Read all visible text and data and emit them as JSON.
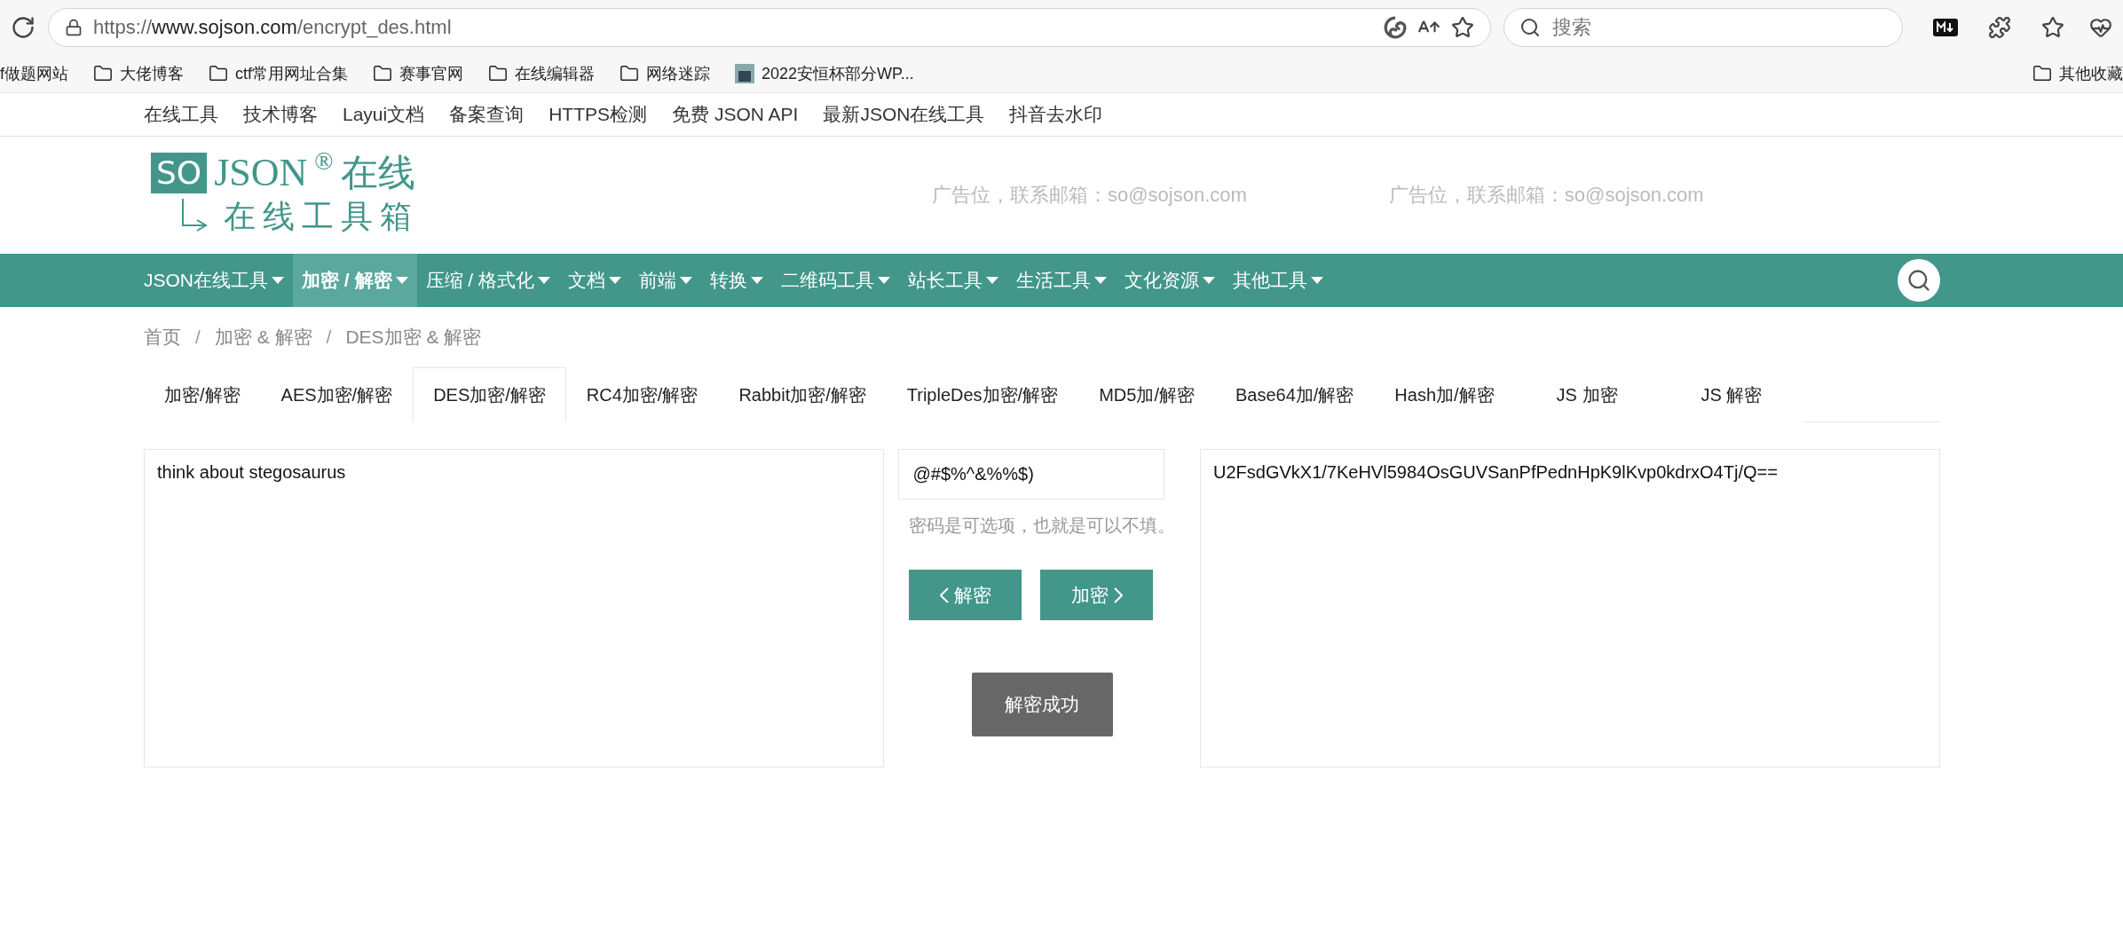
{
  "browser": {
    "address": {
      "scheme": "https://",
      "host": "www.sojson.com",
      "path": "/encrypt_des.html"
    },
    "search": {
      "placeholder": "搜索"
    },
    "bookmarks": [
      {
        "label": "f做题网站",
        "kind": "plain"
      },
      {
        "label": "大佬博客",
        "kind": "folder"
      },
      {
        "label": "ctf常用网址合集",
        "kind": "folder"
      },
      {
        "label": "赛事官网",
        "kind": "folder"
      },
      {
        "label": "在线编辑器",
        "kind": "folder"
      },
      {
        "label": "网络迷踪",
        "kind": "folder"
      },
      {
        "label": "2022安恒杯部分WP...",
        "kind": "page"
      }
    ],
    "other_bookmarks": {
      "label": "其他收藏",
      "kind": "folder"
    }
  },
  "top_links": [
    "在线工具",
    "技术博客",
    "Layui文档",
    "备案查询",
    "HTTPS检测",
    "免费 JSON API",
    "最新JSON在线工具",
    "抖音去水印"
  ],
  "logo": {
    "badge": "SO",
    "name": "JSON",
    "mark": "®",
    "suffix": "在线",
    "tagline": "在线工具箱"
  },
  "ads": [
    "广告位，联系邮箱：so@sojson.com",
    "广告位，联系邮箱：so@sojson.com"
  ],
  "nav": [
    {
      "label": "JSON在线工具",
      "selected": false
    },
    {
      "label": "加密 / 解密",
      "selected": true
    },
    {
      "label": "压缩 / 格式化",
      "selected": false
    },
    {
      "label": "文档",
      "selected": false
    },
    {
      "label": "前端",
      "selected": false
    },
    {
      "label": "转换",
      "selected": false
    },
    {
      "label": "二维码工具",
      "selected": false
    },
    {
      "label": "站长工具",
      "selected": false
    },
    {
      "label": "生活工具",
      "selected": false
    },
    {
      "label": "文化资源",
      "selected": false
    },
    {
      "label": "其他工具",
      "selected": false
    }
  ],
  "breadcrumb": {
    "separator": "/",
    "items": [
      "首页",
      "加密 & 解密",
      "DES加密 & 解密"
    ]
  },
  "tabs": [
    {
      "label": "加密/解密",
      "selected": false
    },
    {
      "label": "AES加密/解密",
      "selected": false
    },
    {
      "label": "DES加密/解密",
      "selected": true
    },
    {
      "label": "RC4加密/解密",
      "selected": false
    },
    {
      "label": "Rabbit加密/解密",
      "selected": false
    },
    {
      "label": "TripleDes加密/解密",
      "selected": false
    },
    {
      "label": "MD5加/解密",
      "selected": false
    },
    {
      "label": "Base64加/解密",
      "selected": false
    },
    {
      "label": "Hash加/解密",
      "selected": false
    },
    {
      "label": "JS 加密",
      "selected": false
    },
    {
      "label": "JS 解密",
      "selected": false
    }
  ],
  "plaintext": {
    "value": "think about stegosaurus"
  },
  "key": {
    "value": "@#$%^&%%$)",
    "hint": "密码是可选项，也就是可以不填。"
  },
  "actions": [
    {
      "label": "解密",
      "kind": "prev"
    },
    {
      "label": "加密",
      "kind": "next"
    }
  ],
  "status": {
    "label": "解密成功"
  },
  "ciphertext": {
    "value": "U2FsdGVkX1/7KeHVl5984OsGUVSanPfPednHpK9lKvp0kdrxO4Tj/Q=="
  }
}
